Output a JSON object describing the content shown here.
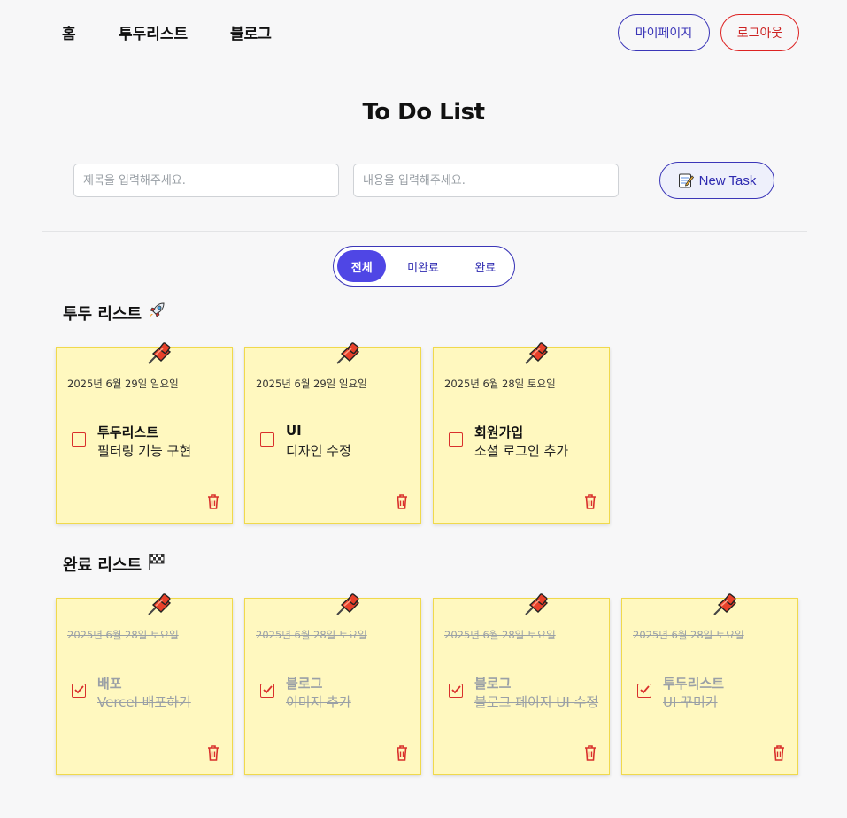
{
  "nav": {
    "home": "홈",
    "todolist": "투두리스트",
    "blog": "블로그"
  },
  "header": {
    "mypage_label": "마이페이지",
    "logout_label": "로그아웃"
  },
  "page_title": "To Do List",
  "form": {
    "title_placeholder": "제목을 입력해주세요.",
    "content_placeholder": "내용을 입력해주세요.",
    "new_task_label": "New Task",
    "new_task_icon": "memo-icon"
  },
  "filter": {
    "all": "전체",
    "incomplete": "미완료",
    "complete": "완료",
    "selected": "전체"
  },
  "sections": {
    "todo_title": "투두 리스트",
    "todo_icon": "rocket-icon",
    "done_title": "완료 리스트",
    "done_icon": "checkered-flag-icon"
  },
  "todo_cards": [
    {
      "date": "2025년 6월 29일 일요일",
      "title": "투두리스트",
      "content": "필터링 기능 구현",
      "done": false
    },
    {
      "date": "2025년 6월 29일 일요일",
      "title": "UI",
      "content": "디자인 수정",
      "done": false
    },
    {
      "date": "2025년 6월 28일 토요일",
      "title": "회원가입",
      "content": "소셜 로그인 추가",
      "done": false
    }
  ],
  "done_cards": [
    {
      "date": "2025년 6월 28일 토요일",
      "title": "배포",
      "content": "Vercel 배포하기",
      "done": true
    },
    {
      "date": "2025년 6월 28일 토요일",
      "title": "블로그",
      "content": "이미지 추가",
      "done": true
    },
    {
      "date": "2025년 6월 28일 토요일",
      "title": "블로그",
      "content": "블로그 페이지 UI 수정",
      "done": true
    },
    {
      "date": "2025년 6월 28일 토요일",
      "title": "투두리스트",
      "content": "UI 꾸미기",
      "done": true
    }
  ],
  "colors": {
    "accent": "#4f46e5",
    "card_bg": "#fff8bf",
    "card_border": "#f0d94c",
    "danger": "#d9302c",
    "pin": "#e8402a"
  }
}
